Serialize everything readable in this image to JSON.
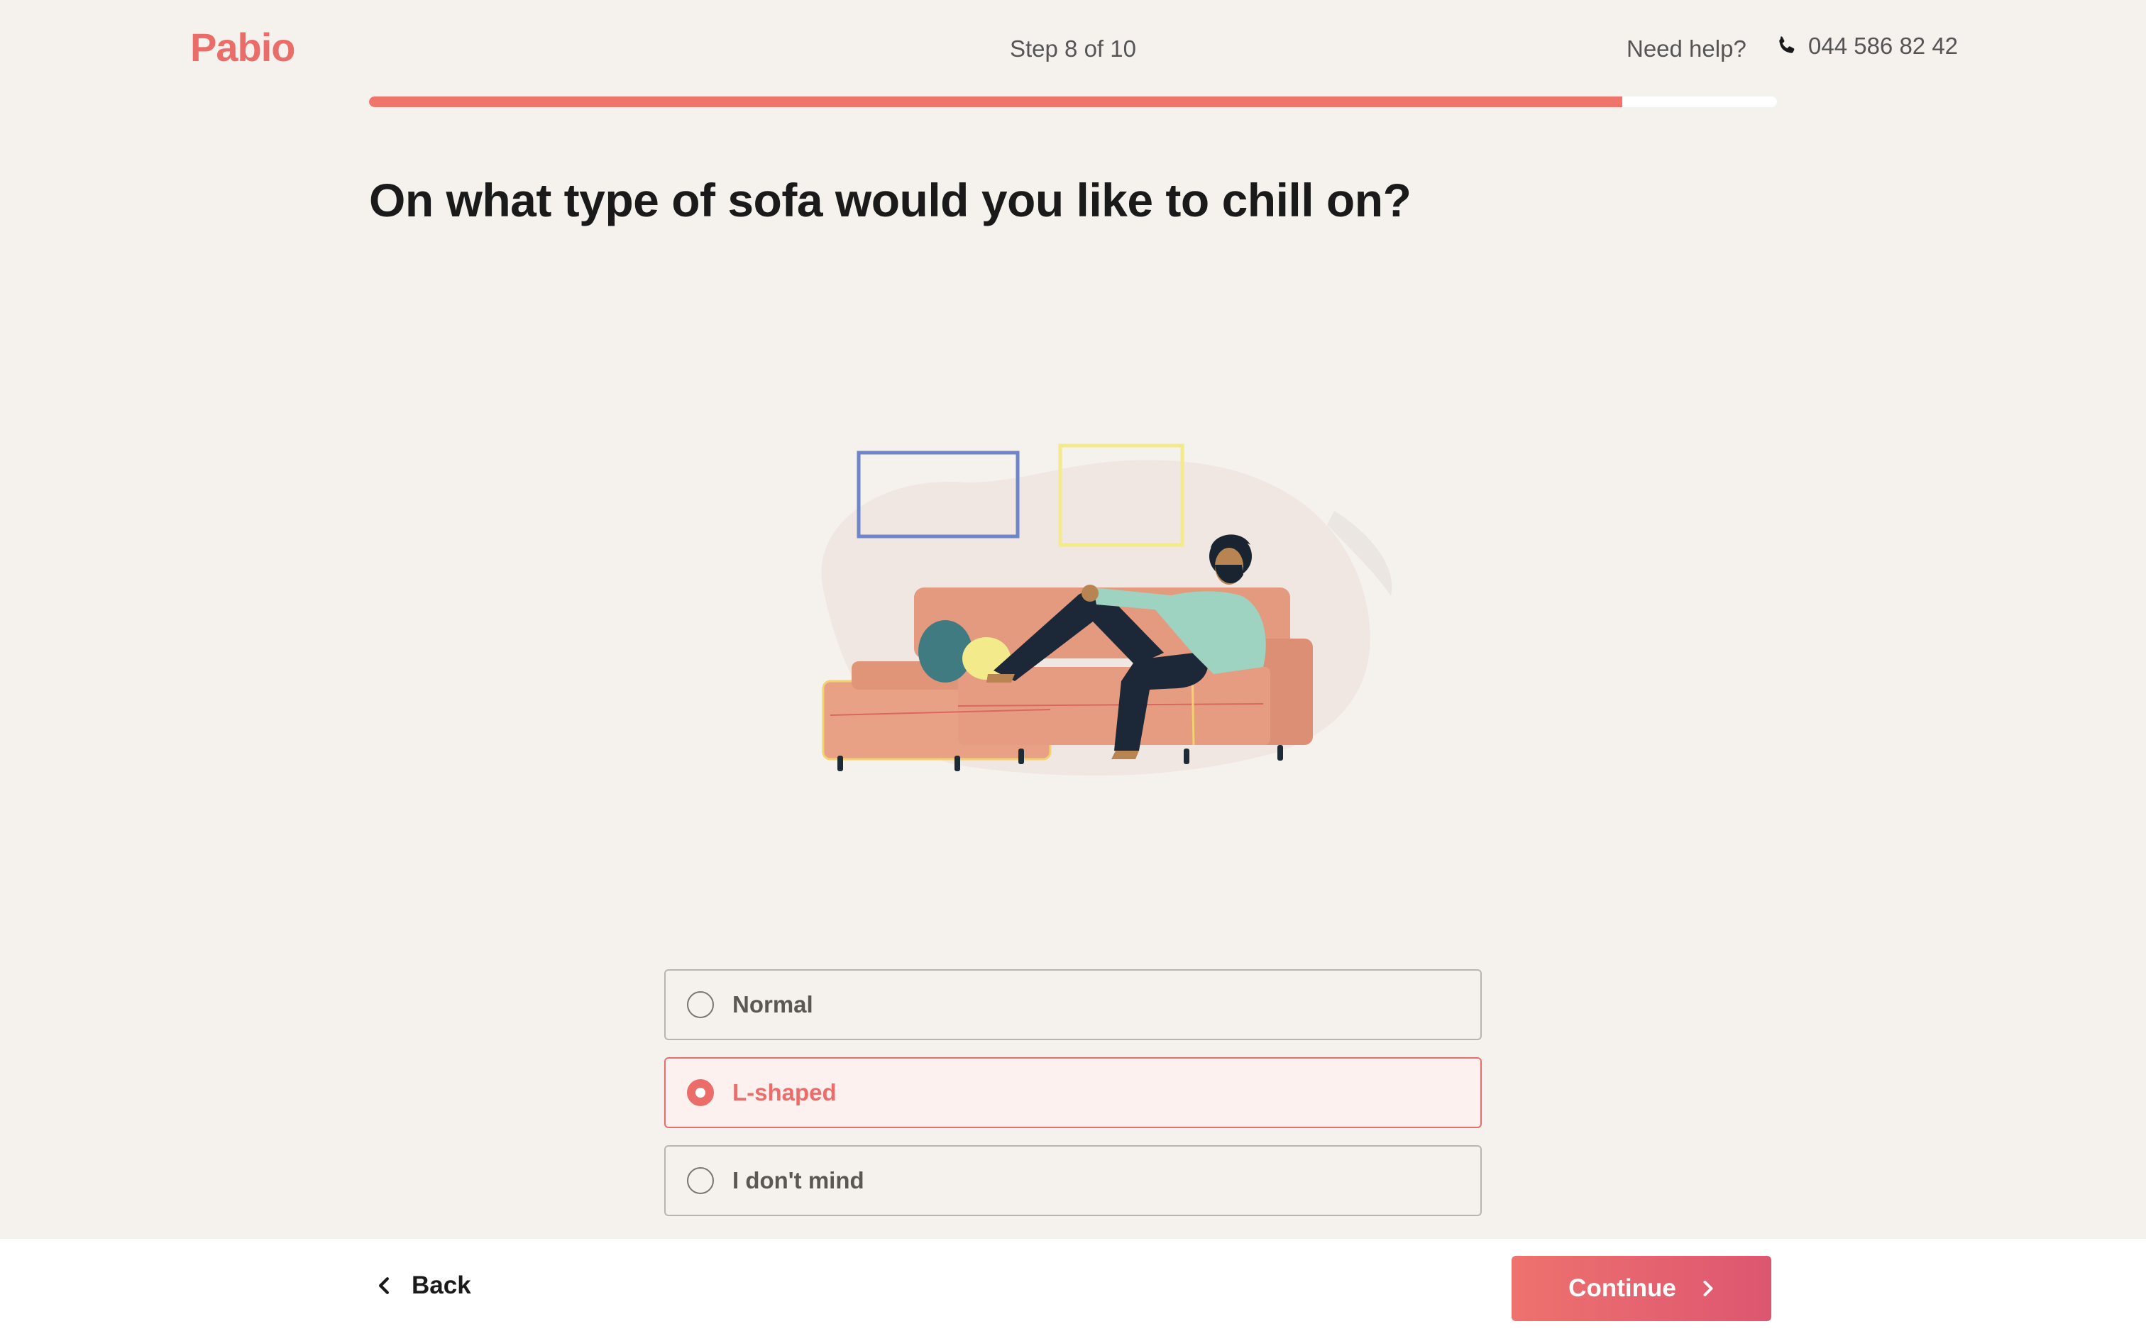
{
  "brand": {
    "name": "Pabio",
    "color": "#ea6d6a"
  },
  "header": {
    "step_label": "Step 8 of 10",
    "help_label": "Need help?",
    "phone_icon": "phone-icon",
    "phone_number": "044 586 82 42"
  },
  "progress": {
    "current_step": 8,
    "total_steps": 10,
    "fill_fraction": 0.89,
    "color": "#ee746c"
  },
  "question": {
    "title": "On what type of sofa would you like to chill on?"
  },
  "illustration": {
    "subject": "man-lounging-on-l-shaped-sofa"
  },
  "options": [
    {
      "label": "Normal",
      "selected": false
    },
    {
      "label": "L-shaped",
      "selected": true
    },
    {
      "label": "I don't mind",
      "selected": false
    }
  ],
  "footer": {
    "back_label": "Back",
    "back_icon": "chevron-left-icon",
    "continue_label": "Continue",
    "continue_icon": "chevron-right-icon",
    "accent": "#e8626e"
  }
}
